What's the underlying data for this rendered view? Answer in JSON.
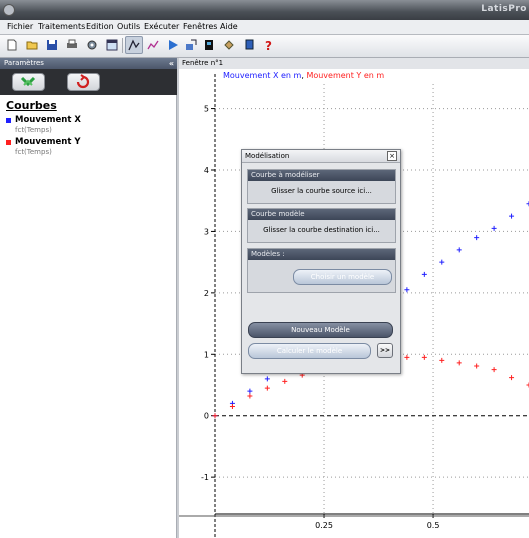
{
  "window": {
    "title": "LatisPro"
  },
  "menu": [
    "Fichier",
    "Traitements",
    "Edition",
    "Outils",
    "Exécuter",
    "Fenêtres",
    "Aide"
  ],
  "toolbar": {
    "icons": [
      "new-file-icon",
      "open-folder-icon",
      "save-icon",
      "print-icon",
      "settings-gear-icon",
      "window-icon",
      "curve-icon",
      "curve-edit-icon",
      "play-icon",
      "export-icon",
      "device-icon",
      "calculator-icon",
      "copy-icon",
      "help-icon"
    ]
  },
  "left_panel": {
    "header": "Paramètres",
    "collapse": "«",
    "section_title": "Courbes",
    "curves": [
      {
        "name": "Mouvement X",
        "sub": "fct(Temps)",
        "color": "#2020ff"
      },
      {
        "name": "Mouvement Y",
        "sub": "fct(Temps)",
        "color": "#ff2020"
      }
    ]
  },
  "graph_window": {
    "title": "Fenêtre n°1"
  },
  "chart_data": {
    "type": "scatter",
    "legend": [
      {
        "text": "Mouvement X en m",
        "color": "#2020ff"
      },
      {
        "text": "Mouvement Y en m",
        "color": "#ff2020"
      }
    ],
    "ylim": [
      -1.6,
      5.4
    ],
    "xlim": [
      0,
      0.72
    ],
    "y_ticks": [
      "5",
      "4",
      "3",
      "2",
      "1",
      "0",
      "-1"
    ],
    "x_ticks": [
      "0.25",
      "0.5"
    ],
    "grid": true,
    "series": [
      {
        "name": "Mouvement X",
        "color": "#2020ff",
        "x": [
          0,
          0.04,
          0.08,
          0.12,
          0.2,
          0.24,
          0.28,
          0.32,
          0.36,
          0.4,
          0.44,
          0.48,
          0.52,
          0.56,
          0.6,
          0.64,
          0.68,
          0.72
        ],
        "y": [
          0.0,
          0.2,
          0.4,
          0.6,
          0.9,
          1.1,
          1.25,
          1.45,
          1.65,
          1.85,
          2.05,
          2.3,
          2.5,
          2.7,
          2.9,
          3.05,
          3.25,
          3.45
        ]
      },
      {
        "name": "Mouvement Y",
        "color": "#ff2020",
        "x": [
          0,
          0.04,
          0.08,
          0.12,
          0.16,
          0.2,
          0.44,
          0.48,
          0.52,
          0.56,
          0.6,
          0.64,
          0.68,
          0.72
        ],
        "y": [
          0.0,
          0.15,
          0.32,
          0.45,
          0.56,
          0.66,
          0.95,
          0.95,
          0.9,
          0.86,
          0.81,
          0.75,
          0.62,
          0.5
        ]
      }
    ]
  },
  "dialog": {
    "title": "Modélisation",
    "close": "×",
    "source_header": "Courbe à modéliser",
    "source_text": "Glisser la courbe source ici...",
    "model_header": "Courbe modèle",
    "model_text": "Glisser la courbe destination ici...",
    "models_header": "Modèles :",
    "choose_model": "Choisir un modèle",
    "new_model": "Nouveau Modèle",
    "compute": "Calculer le modèle",
    "more": ">>"
  }
}
